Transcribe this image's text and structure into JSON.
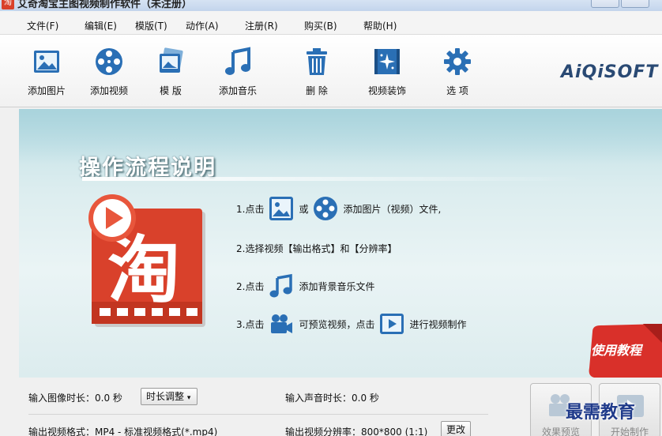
{
  "window": {
    "title": "艾奇淘宝主图视频制作软件（未注册）"
  },
  "menu": [
    {
      "label": "文件(F)"
    },
    {
      "label": "编辑(E)"
    },
    {
      "label": "模版(T)"
    },
    {
      "label": "动作(A)"
    },
    {
      "label": "注册(R)"
    },
    {
      "label": "购买(B)"
    },
    {
      "label": "帮助(H)"
    }
  ],
  "toolbar": {
    "items": [
      {
        "label": "添加图片",
        "icon": "image-icon"
      },
      {
        "label": "添加视频",
        "icon": "film-reel-icon"
      },
      {
        "label": "模 版",
        "icon": "template-icon"
      },
      {
        "label": "添加音乐",
        "icon": "music-note-icon"
      },
      {
        "label": "删 除",
        "icon": "trash-icon"
      },
      {
        "label": "视频装饰",
        "icon": "sparkle-film-icon"
      },
      {
        "label": "选 项",
        "icon": "gear-icon"
      }
    ],
    "brand": "AiQiSOFT"
  },
  "banner": {
    "title": "操作流程说明",
    "steps": [
      {
        "prefix": "1.点击",
        "middle": "或",
        "suffix": "添加图片（视频）文件,"
      },
      {
        "text": "2.选择视频【输出格式】和【分辨率】"
      },
      {
        "prefix": "2.点击",
        "suffix": "添加背景音乐文件"
      },
      {
        "prefix": "3.点击",
        "middle": "可预览视频，点击",
        "suffix": "进行视频制作"
      }
    ],
    "tutorial_label": "使用教程"
  },
  "settings": {
    "image_duration_label": "输入图像时长：0.0 秒",
    "duration_adjust_label": "时长调整",
    "audio_duration_label": "输入声音时长：0.0 秒",
    "output_format_label": "输出视频格式：MP4 - 标准视频格式(*.mp4)",
    "output_resolution_label": "输出视频分辨率：800*800 (1:1)",
    "change_label": "更改"
  },
  "actions": {
    "preview_label": "效果预览",
    "start_label": "开始制作"
  },
  "watermark": "最需教育",
  "colors": {
    "accent_blue": "#2a6fb5",
    "logo_red": "#d9412b",
    "banner_teal": "#bfe0e6"
  }
}
